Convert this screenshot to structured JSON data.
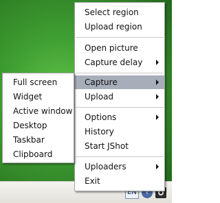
{
  "main_menu": {
    "items": [
      {
        "label": "Select region"
      },
      {
        "label": "Upload region"
      },
      {
        "label": "Open picture"
      },
      {
        "label": "Capture delay"
      },
      {
        "label": "Capture"
      },
      {
        "label": "Upload"
      },
      {
        "label": "Options"
      },
      {
        "label": "History"
      },
      {
        "label": "Start JShot"
      },
      {
        "label": "Uploaders"
      },
      {
        "label": "Exit"
      }
    ]
  },
  "capture_submenu": {
    "items": [
      {
        "label": "Full screen"
      },
      {
        "label": "Widget"
      },
      {
        "label": "Active window"
      },
      {
        "label": "Desktop"
      },
      {
        "label": "Taskbar"
      },
      {
        "label": "Clipboard"
      }
    ]
  },
  "tray": {
    "language": "EN",
    "icons": [
      "show-hidden-icons-arrow",
      "jshot-tray-icon"
    ]
  },
  "colors": {
    "menu_background": "#ffffff",
    "highlight": "#a7adb9",
    "desktop_green": "#3f9e32"
  }
}
